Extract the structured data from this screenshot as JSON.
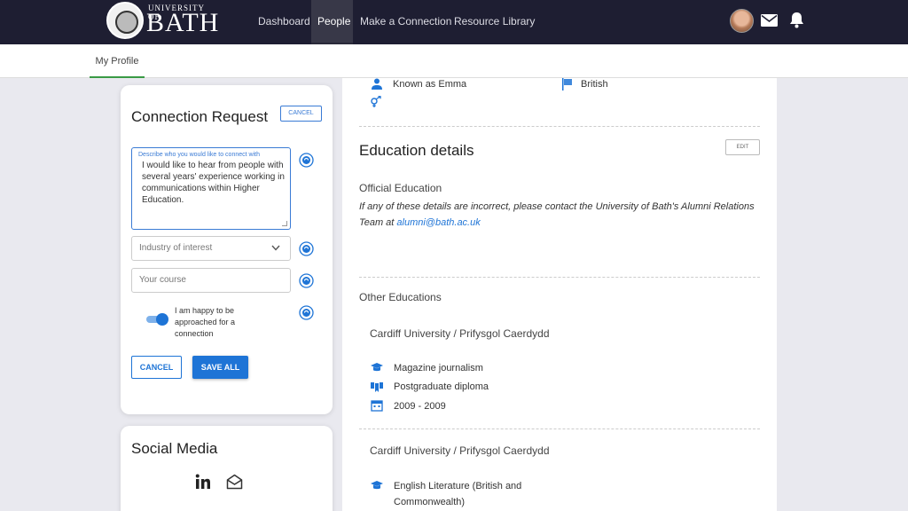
{
  "header": {
    "logo": {
      "small": "UNIVERSITY OF",
      "big": "BATH"
    },
    "nav": [
      "Dashboard",
      "People",
      "Make a Connection",
      "Resource Library"
    ],
    "active_nav": "People"
  },
  "subnav": {
    "tab": "My Profile"
  },
  "connection_request": {
    "title": "Connection Request",
    "cancel_small": "CANCEL",
    "describe_label": "Describe who you would like to connect with",
    "describe_value": "I would like to hear from people with several years' experience working in communications within Higher Education.",
    "industry_placeholder": "Industry of interest",
    "course_placeholder": "Your course",
    "toggle_label": "I am happy to be approached for a connection",
    "toggle_on": true,
    "cancel": "CANCEL",
    "save": "SAVE ALL"
  },
  "social": {
    "title": "Social Media"
  },
  "profile": {
    "known_as": "Known as Emma",
    "nationality": "British"
  },
  "education": {
    "title": "Education details",
    "edit": "EDIT",
    "official_heading": "Official Education",
    "note_prefix": "If any of these details are incorrect, please contact the University of Bath's Alumni Relations Team at ",
    "note_email": "alumni@bath.ac.uk",
    "other_heading": "Other Educations",
    "entries": [
      {
        "institution": "Cardiff University / Prifysgol Caerdydd",
        "subject": "Magazine journalism",
        "qualification": "Postgraduate diploma",
        "dates": "2009 - 2009"
      },
      {
        "institution": "Cardiff University / Prifysgol Caerdydd",
        "subject": "English Literature (British and Commonwealth)"
      }
    ]
  },
  "colors": {
    "navbar": "#1e1e32",
    "accent": "#1e74d6",
    "tab_underline": "#3a9a45"
  }
}
